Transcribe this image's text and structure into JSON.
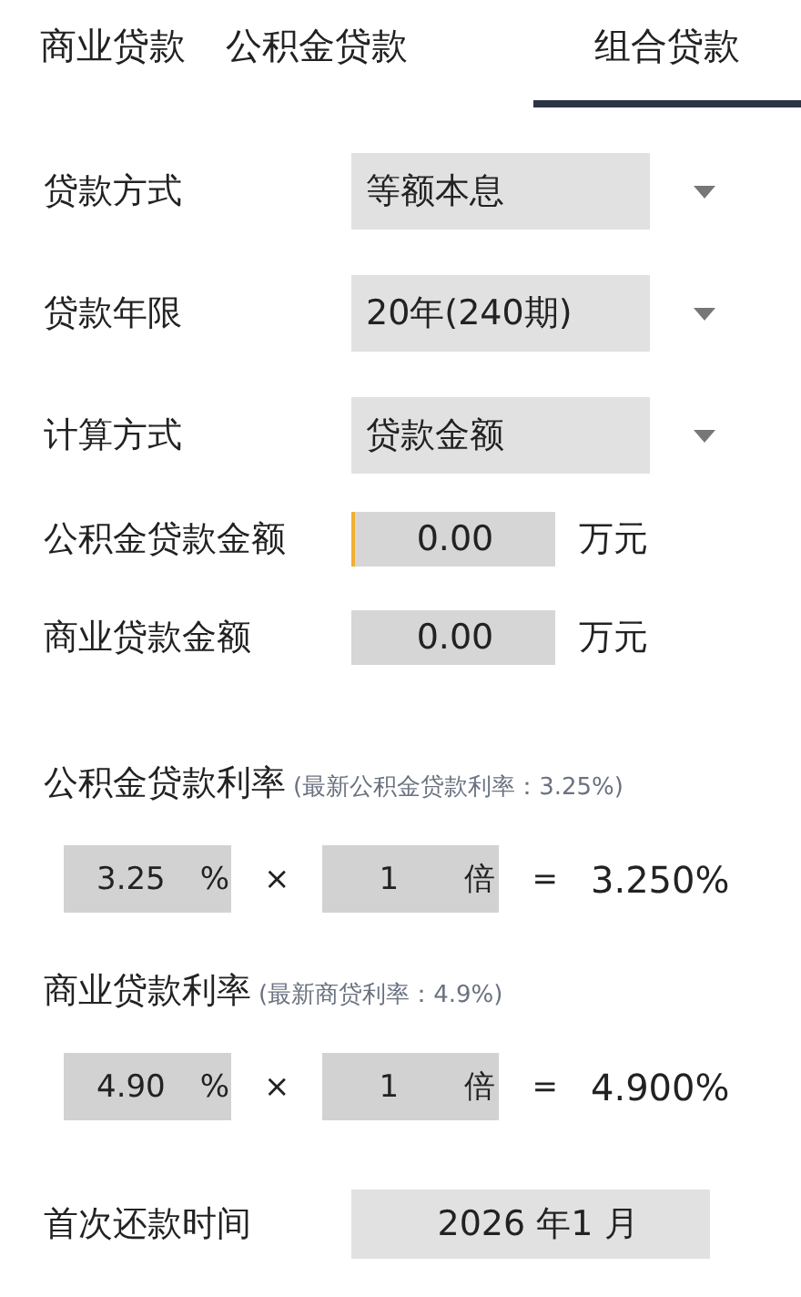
{
  "tabs": [
    {
      "label": "商业贷款",
      "selected": false
    },
    {
      "label": "公积金贷款",
      "selected": false
    },
    {
      "label": "组合贷款",
      "selected": true
    }
  ],
  "selects": [
    {
      "label": "贷款方式",
      "value": "等额本息"
    },
    {
      "label": "贷款年限",
      "value": "20年(240期)"
    },
    {
      "label": "计算方式",
      "value": "贷款金额"
    }
  ],
  "amounts": [
    {
      "label": "公积金贷款金额",
      "value": "0.00",
      "unit": "万元",
      "focused": true
    },
    {
      "label": "商业贷款金额",
      "value": "0.00",
      "unit": "万元",
      "focused": false
    }
  ],
  "rates": [
    {
      "title": "公积金贷款利率",
      "note": "(最新公积金贷款利率：3.25%)",
      "rate": "3.25",
      "percent": "%",
      "times": "×",
      "multiple": "1",
      "multiple_unit": "倍",
      "equals": "=",
      "result": "3.250%"
    },
    {
      "title": "商业贷款利率",
      "note": "(最新商贷利率：4.9%)",
      "rate": "4.90",
      "percent": "%",
      "times": "×",
      "multiple": "1",
      "multiple_unit": "倍",
      "equals": "=",
      "result": "4.900%"
    }
  ],
  "first_payment": {
    "label": "首次还款时间",
    "value": "2026 年1 月"
  }
}
